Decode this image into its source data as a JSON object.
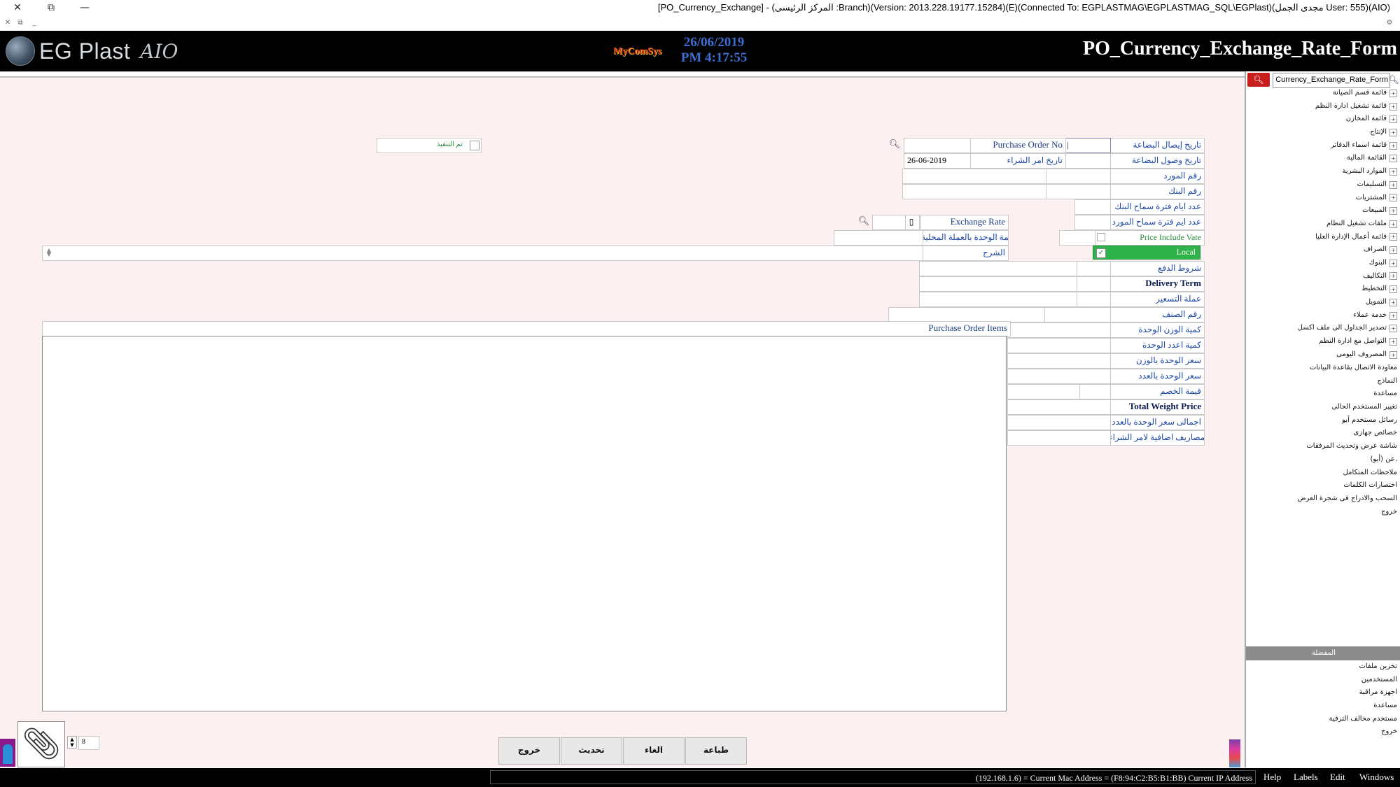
{
  "window": {
    "title": "[PO_Currency_Exchange] - (المركز الرئيسى :Branch)(Version: 2013.228.19177.15284)(E)(Connected To: EGPLASTMAG\\EGPLASTMAG_SQL\\EGPlast)(مجدى الجمل User: 555)(AIO)",
    "close": "✕",
    "restore": "⧉",
    "minimize": "—"
  },
  "header": {
    "logo_text": "EG Plast",
    "logo_sig": "AIO",
    "vendor": "MyComSys",
    "date": "26/06/2019",
    "time": "PM 4:17:55",
    "form_title": "PO_Currency_Exchange_Rate_Form"
  },
  "form": {
    "executed_label": "تم التنفيذ",
    "receive_date_label": "تاريخ إيصال البضاعة",
    "po_no_label": "Purchase Order No",
    "arrival_date_label": "تاريخ وصول البضاعة",
    "po_date_label": "تاريخ امر الشراء",
    "po_date_value": "26-06-2019",
    "supplier_no_label": "رقم المورد",
    "bank_no_label": "رقم البنك",
    "bank_days_label": "عدد ايام فترة سماح البنك",
    "supplier_days_label": "عدد ايم فترة سماح المورد",
    "exchange_rate_label": "Exchange Rate",
    "local_unit_value_label": "قيمة الوحدة بالعملة المحلية",
    "price_include_vat_label": "Price Include Vate",
    "explanation_label": "الشرح",
    "local_label": "Local",
    "payment_terms_label": "شروط الدفع",
    "delivery_term_label": "Delivery Term",
    "pricing_currency_label": "عملة التسعير",
    "item_no_label": "رقم الصنف",
    "weight_qty_label": "كمية الوزن الوحدة",
    "count_qty_label": "كمية اعدد الوحدة",
    "unit_price_weight_label": "سعر الوحدة بالوزن",
    "unit_price_count_label": "سعر الوحدة بالعدد",
    "discount_label": "قيمة الخصم",
    "total_weight_price_label": "Total Weight Price",
    "total_unit_price_label": "اجمالى سعر الوحدة بالعدد",
    "extra_expenses_label": "مصاريف اضافية لامر الشراء",
    "po_items_label": "Purchase Order Items",
    "attachment_count": "8"
  },
  "buttons": {
    "exit": "خروج",
    "update": "تحديث",
    "cancel": "الغاء",
    "print": "طباعة"
  },
  "rpanel": {
    "search_value": "Currency_Exchange_Rate_Form",
    "tree": [
      "قائمة قسم الصيانة",
      "قائمة تشغيل ادارة النظم",
      "قائمة المخازن",
      "الإنتاج",
      "قائمة اسماء الدفاتر",
      "القائمة المالية",
      "الموارد البشرية",
      "التسليمات",
      "المشتريات",
      "المبيعات",
      "ملفات تشغيل النظام",
      "قائمة أعمال الإدارة العليا",
      "الصراف",
      "البنوك",
      "التكاليف",
      "التخطيط",
      "التمويل",
      "خدمة عملاء",
      "تصدير الجداول الى ملف اكسل",
      "التواصل مع ادارة النظم",
      "المصروف اليومى"
    ],
    "tree_leaves": [
      "معاودة الاتصال بقاعدة البيانات",
      "النماذج",
      "مساعدة",
      "تغيير المستخدم الحالى",
      "رسائل مستخدم آيو",
      "خصائص جهازى",
      "شاشة عرض وتحديث المرفقات",
      "عن (أيو).",
      "ملاحظات المتكامل",
      "اختصارات الكلمات",
      "السحب والادراج فى شجرة العرض",
      "خروج"
    ],
    "section_title": "المفضلة",
    "fav": [
      "تخزين ملفات",
      "المستخدمين",
      "اجهزة مراقبة",
      "مساعدة",
      "مستخدم مخالف الترقية",
      "خروج"
    ]
  },
  "status": {
    "ip": "(192.168.1.6) = Current Mac Address = (F8:94:C2:B5:B1:BB) Current IP Address",
    "menus": [
      "Help",
      "Labels",
      "Edit",
      "Windows"
    ]
  }
}
